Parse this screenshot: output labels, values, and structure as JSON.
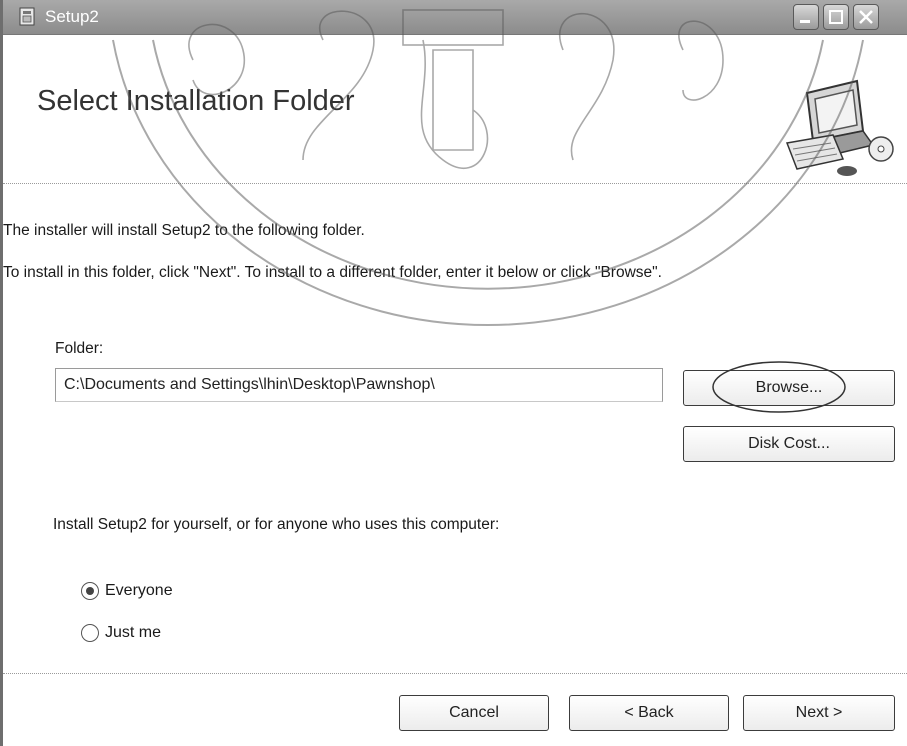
{
  "window": {
    "title": "Setup2"
  },
  "header": {
    "title": "Select Installation Folder"
  },
  "body": {
    "intro_line1": "The installer will install Setup2 to the following folder.",
    "intro_line2": "To install in this folder, click \"Next\". To install to a different folder, enter it below or click \"Browse\".",
    "folder_label": "Folder:",
    "folder_value": "C:\\Documents and Settings\\lhin\\Desktop\\Pawnshop\\",
    "browse_label": "Browse...",
    "disk_cost_label": "Disk Cost...",
    "install_for_label": "Install Setup2 for yourself, or for anyone who uses this computer:",
    "options": [
      {
        "label": "Everyone",
        "selected": true
      },
      {
        "label": "Just me",
        "selected": false
      }
    ]
  },
  "footer": {
    "cancel_label": "Cancel",
    "back_label": "< Back",
    "next_label": "Next >"
  },
  "watermark_text": "ขอมเกลาเจาคุณทหาร"
}
